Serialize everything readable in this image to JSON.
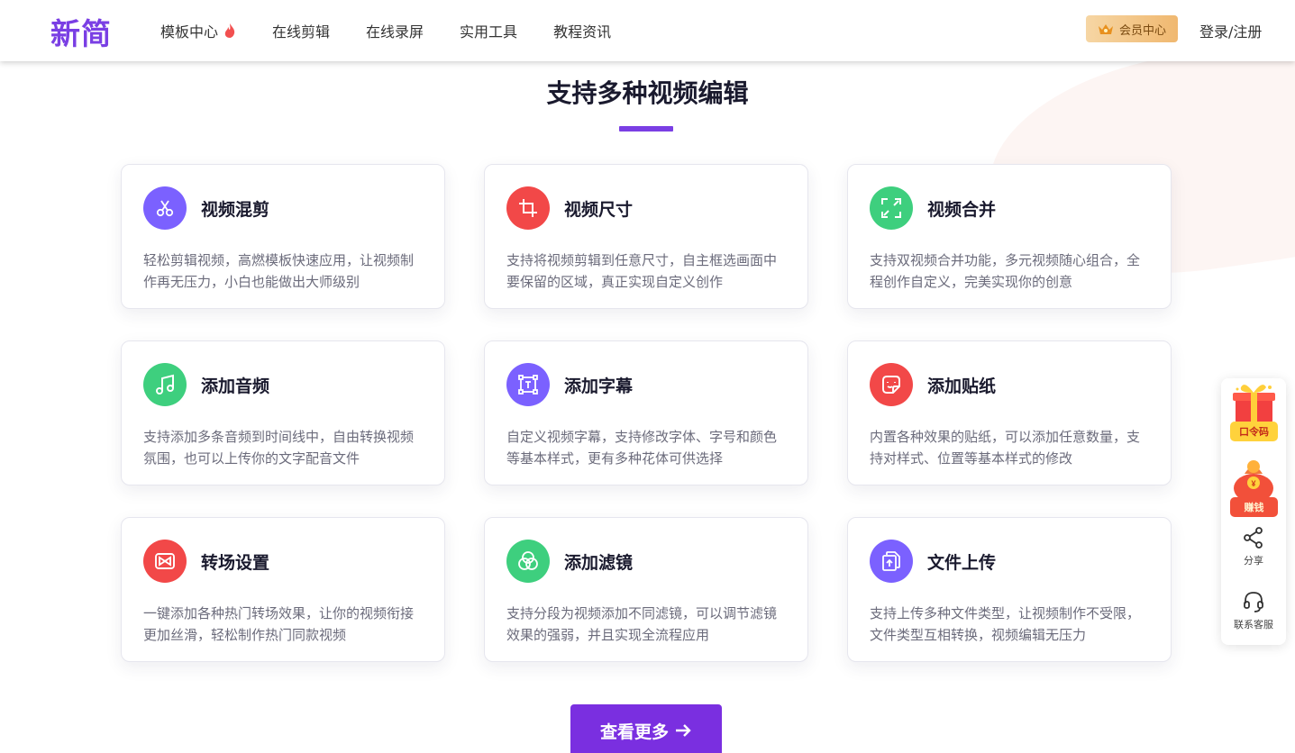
{
  "header": {
    "logo": "新简",
    "nav": [
      {
        "label": "模板中心",
        "hot": true
      },
      {
        "label": "在线剪辑"
      },
      {
        "label": "在线录屏"
      },
      {
        "label": "实用工具"
      },
      {
        "label": "教程资讯"
      }
    ],
    "vip_label": "会员中心",
    "login_label": "登录/注册"
  },
  "section": {
    "title": "支持多种视频编辑"
  },
  "features": [
    {
      "title": "视频混剪",
      "desc": "轻松剪辑视频，高燃模板快速应用，让视频制作再无压力，小白也能做出大师级别",
      "icon": "scissors-icon",
      "color": "#7b61ff"
    },
    {
      "title": "视频尺寸",
      "desc": "支持将视频剪辑到任意尺寸，自主框选画面中要保留的区域，真正实现自定义创作",
      "icon": "crop-icon",
      "color": "#f24848"
    },
    {
      "title": "视频合并",
      "desc": "支持双视频合并功能，多元视频随心组合，全程创作自定义，完美实现你的创意",
      "icon": "expand-icon",
      "color": "#3ecf7e"
    },
    {
      "title": "添加音频",
      "desc": "支持添加多条音频到时间线中，自由转换视频氛围，也可以上传你的文字配音文件",
      "icon": "music-icon",
      "color": "#3ecf7e"
    },
    {
      "title": "添加字幕",
      "desc": "自定义视频字幕，支持修改字体、字号和颜色等基本样式，更有多种花体可供选择",
      "icon": "text-box-icon",
      "color": "#7b61ff"
    },
    {
      "title": "添加贴纸",
      "desc": "内置各种效果的贴纸，可以添加任意数量，支持对样式、位置等基本样式的修改",
      "icon": "sticker-icon",
      "color": "#f24848"
    },
    {
      "title": "转场设置",
      "desc": "一键添加各种热门转场效果，让你的视频衔接更加丝滑，轻松制作热门同款视频",
      "icon": "transition-icon",
      "color": "#f24848"
    },
    {
      "title": "添加滤镜",
      "desc": "支持分段为视频添加不同滤镜，可以调节滤镜效果的强弱，并且实现全流程应用",
      "icon": "filter-icon",
      "color": "#3ecf7e"
    },
    {
      "title": "文件上传",
      "desc": "支持上传多种文件类型，让视频制作不受限，文件类型互相转换，视频编辑无压力",
      "icon": "file-upload-icon",
      "color": "#7b61ff"
    }
  ],
  "more_button": {
    "label": "查看更多"
  },
  "side_panel": {
    "gift_label": "口令码",
    "earn_label": "赚钱",
    "share_label": "分享",
    "service_label": "联系客服"
  }
}
